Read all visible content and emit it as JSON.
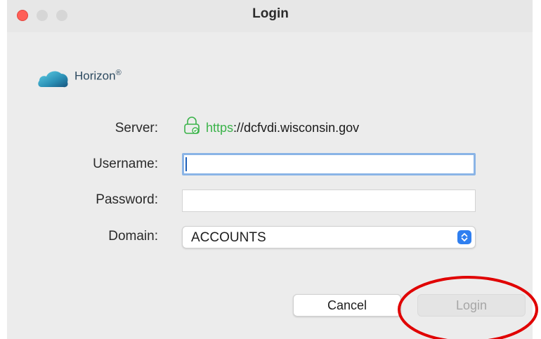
{
  "window": {
    "title": "Login"
  },
  "brand": {
    "name": "Horizon",
    "mark": "®"
  },
  "form": {
    "server_label": "Server:",
    "server_protocol": "https",
    "server_rest": "://dcfvdi.wisconsin.gov",
    "username_label": "Username:",
    "username_value": "",
    "password_label": "Password:",
    "password_value": "",
    "domain_label": "Domain:",
    "domain_value": "ACCOUNTS"
  },
  "buttons": {
    "cancel": "Cancel",
    "login": "Login"
  },
  "colors": {
    "close": "#ff5f57",
    "protocol_green": "#3bb34a",
    "focus_ring": "#8ab4e6",
    "select_accent": "#2f7ff0",
    "annotation_red": "#e00000"
  },
  "icons": [
    "lock-icon",
    "horizon-logo",
    "chevron-updown-icon"
  ]
}
